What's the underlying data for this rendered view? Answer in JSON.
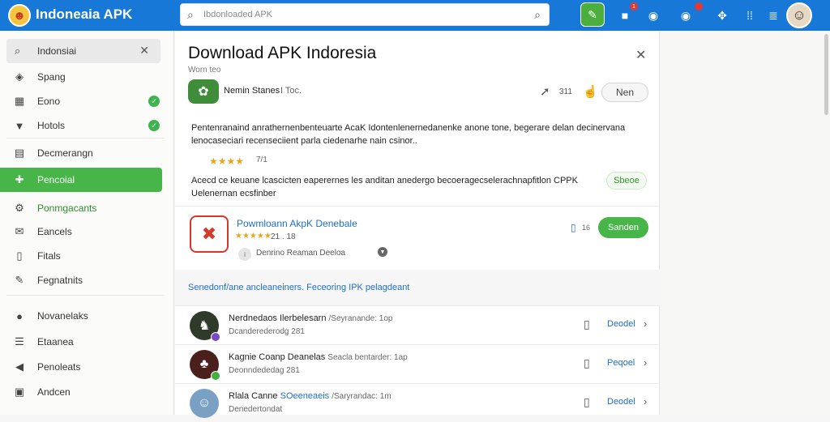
{
  "header": {
    "brand": "Indoneaia APK",
    "search_placeholder": "Ibdonloaded APK",
    "notif_counts": [
      "1"
    ]
  },
  "sidebar": {
    "search_value": "Indonsiai",
    "items": [
      {
        "label": "Spang",
        "icon": "shield-icon"
      },
      {
        "label": "Eono",
        "icon": "calendar-icon",
        "check": true
      },
      {
        "label": "Hotols",
        "icon": "tag-icon",
        "check": true
      },
      {
        "label": "Decmerangn",
        "icon": "briefcase-icon"
      },
      {
        "label": "Pencoial",
        "icon": "puzzle-icon",
        "active": true
      },
      {
        "label": "Ponmgacants",
        "icon": "gear-icon",
        "green": true
      },
      {
        "label": "Eancels",
        "icon": "mail-icon"
      },
      {
        "label": "Fitals",
        "icon": "clipboard-icon"
      },
      {
        "label": "Fegnatnits",
        "icon": "pencil-icon"
      },
      {
        "label": "Novanelaks",
        "icon": "user-icon"
      },
      {
        "label": "Etaanea",
        "icon": "list-icon"
      },
      {
        "label": "Penoleats",
        "icon": "arrow-left-icon"
      },
      {
        "label": "Andcen",
        "icon": "image-icon"
      }
    ]
  },
  "main": {
    "title": "Download APK Indoresia",
    "subtitle": "Worn teo",
    "publisher": "Nemin Stanes",
    "publisher_meta": "I Toc.",
    "share_count": "311",
    "new_label": "Nen",
    "para1_l1": "Pentenranaind anrathernenbenteuarte AcaK Idontenlenernedanenke anone tone, begerare delan decinervana",
    "para1_l2": "lenocaseciari recenseciient parla ciedenarhe nain csinor..",
    "stars": "★★★★",
    "rating": "7/1",
    "para2_l1": "Acecd ce keuane lcascicten eaperernes les anditan anedergo becoeragecselerachnapfitlon CPPK",
    "para2_l2": "Uelenernan ecsfinber",
    "side_btn": "Sbeoe",
    "app": {
      "name": "Powmloann AkpK Denebale",
      "stars": "★★★★★",
      "meta": "21 . 18",
      "info": "Denrino   Reaman   Deeloa",
      "size": "16",
      "download_label": "Sanden"
    },
    "rec_label": "Senedonf/ane ancleaneiners. Feceoring IPK pelagdeant",
    "rows": [
      {
        "title": "Nerdnedaos Ilerbelesarn",
        "meta": "/Seyranande: 1op",
        "sub": "Dcanderederodg   281",
        "btn": "Deodel",
        "color": "#2f3a2a"
      },
      {
        "title": "Kagnie Coanp Deanelas",
        "meta": "Seacla bentarder: 1ap",
        "sub": "Deonndededag   281",
        "btn": "Peqoel",
        "color": "#4a1f1c"
      },
      {
        "title": "Rlala Canne",
        "meta": "/Saryrandac: 1m",
        "sub": "Denedertondat",
        "btn": "Deodel",
        "color": "#7aa0c4",
        "title2": "SOeeneaeis"
      }
    ]
  },
  "colors": {
    "primary": "#1778d8",
    "accent": "#47b548",
    "link": "#1f6fc7"
  }
}
